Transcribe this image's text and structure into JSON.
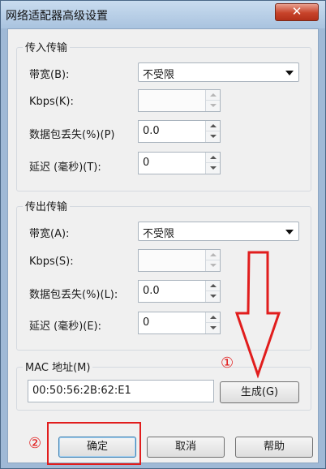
{
  "window": {
    "title": "网络适配器高级设置",
    "close_label": "✕"
  },
  "inbound": {
    "group_label": "传入传输",
    "bandwidth_label": "带宽(B):",
    "bandwidth_value": "不受限",
    "kbps_label": "Kbps(K):",
    "kbps_value": "",
    "packet_loss_label": "数据包丢失(%)(P)",
    "packet_loss_value": "0.0",
    "delay_label": "延迟 (毫秒)(T):",
    "delay_value": "0"
  },
  "outbound": {
    "group_label": "传出传输",
    "bandwidth_label": "带宽(A):",
    "bandwidth_value": "不受限",
    "kbps_label": "Kbps(S):",
    "kbps_value": "",
    "packet_loss_label": "数据包丢失(%)(L):",
    "packet_loss_value": "0.0",
    "delay_label": "延迟 (毫秒)(E):",
    "delay_value": "0"
  },
  "mac": {
    "label": "MAC 地址(M)",
    "value": "00:50:56:2B:62:E1",
    "generate_label": "生成(G)"
  },
  "footer": {
    "ok_label": "确定",
    "cancel_label": "取消",
    "help_label": "帮助"
  },
  "annotations": {
    "marker_1": "①",
    "marker_2": "②",
    "color": "#e11d1d"
  }
}
